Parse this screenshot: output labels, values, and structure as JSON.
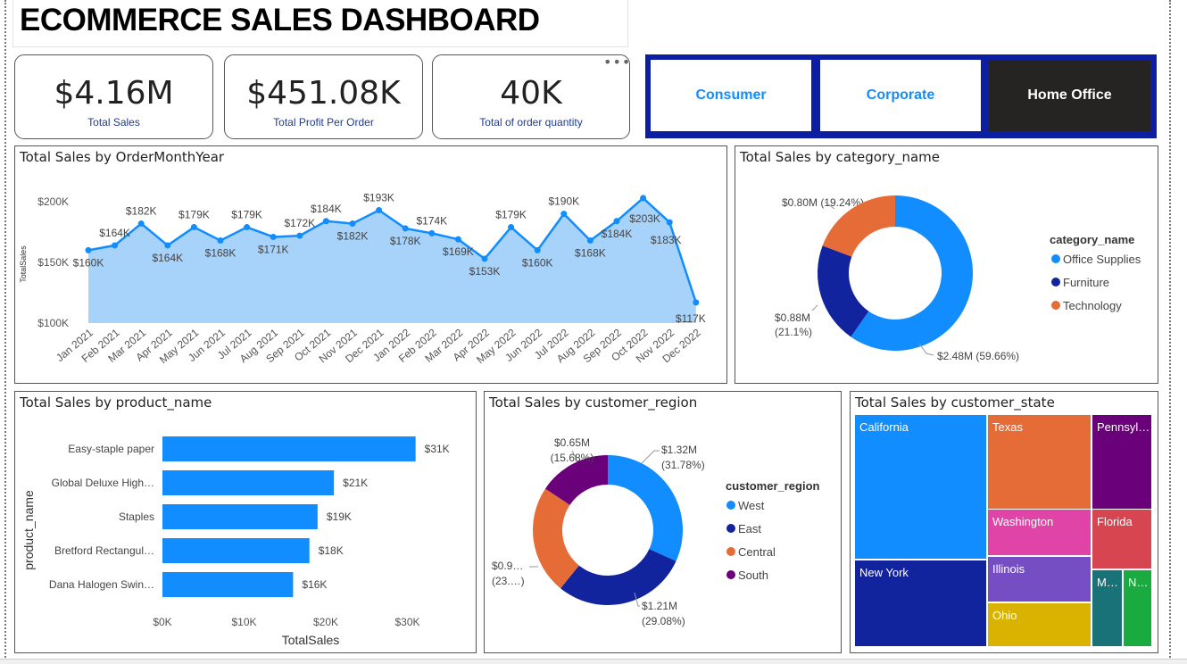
{
  "dashboard": {
    "title": "ECOMMERCE SALES DASHBOARD"
  },
  "kpis": [
    {
      "value": "$4.16M",
      "label": "Total Sales"
    },
    {
      "value": "$451.08K",
      "label": "Total Profit Per Order"
    },
    {
      "value": "40K",
      "label": "Total of order quantity"
    }
  ],
  "kpi_more_icon": "more-options-icon",
  "segment_slicer": {
    "options": [
      "Consumer",
      "Corporate",
      "Home Office"
    ],
    "selected": "Home Office",
    "colors": {
      "frame": "#0c1fa2",
      "selected_bg": "#252423",
      "text": "#118dff"
    }
  },
  "panels": {
    "monthly": "Total Sales by OrderMonthYear",
    "category": "Total Sales by category_name",
    "product": "Total Sales by product_name",
    "region": "Total Sales by customer_region",
    "state": "Total Sales by customer_state"
  },
  "chart_data": [
    {
      "type": "area",
      "title": "Total Sales by OrderMonthYear",
      "ylabel": "TotalSales",
      "xlabel": "",
      "x": [
        "Jan 2021",
        "Feb 2021",
        "Mar 2021",
        "Apr 2021",
        "May 2021",
        "Jun 2021",
        "Jul 2021",
        "Aug 2021",
        "Sep 2021",
        "Oct 2021",
        "Nov 2021",
        "Dec 2021",
        "Jan 2022",
        "Feb 2022",
        "Mar 2022",
        "Apr 2022",
        "May 2022",
        "Jun 2022",
        "Jul 2022",
        "Aug 2022",
        "Sep 2022",
        "Oct 2022",
        "Nov 2022",
        "Dec 2022"
      ],
      "values": [
        160,
        164,
        182,
        164,
        179,
        168,
        179,
        171,
        172,
        184,
        182,
        193,
        178,
        174,
        169,
        153,
        179,
        160,
        190,
        168,
        184,
        203,
        183,
        117
      ],
      "labels": [
        "$160K",
        "$164K",
        "$182K",
        "$164K",
        "$179K",
        "$168K",
        "$179K",
        "$171K",
        "$172K",
        "$184K",
        "$182K",
        "$193K",
        "$178K",
        "$174K",
        "$169K",
        "$153K",
        "$179K",
        "$160K",
        "$190K",
        "$168K",
        "$184K",
        "$203K",
        "$183K",
        "$117K"
      ],
      "yticks": [
        "$100K",
        "$150K",
        "$200K"
      ],
      "ylim": [
        100,
        210
      ],
      "colors": {
        "line": "#118dff",
        "fill": "#a7d2fa"
      }
    },
    {
      "type": "pie",
      "title": "Total Sales by category_name",
      "legend_title": "category_name",
      "legend_position": "right",
      "categories": [
        "Office Supplies",
        "Furniture",
        "Technology"
      ],
      "values": [
        59.66,
        21.1,
        19.24
      ],
      "labels": [
        "$2.48M (59.66%)",
        "$0.88M (21.1%)",
        "$0.80M (19.24%)"
      ],
      "colors": [
        "#118dff",
        "#12239e",
        "#e66c37"
      ]
    },
    {
      "type": "bar",
      "orientation": "horizontal",
      "title": "Total Sales by product_name",
      "ylabel": "product_name",
      "xlabel": "TotalSales",
      "categories": [
        "Easy-staple paper",
        "Global Deluxe High…",
        "Staples",
        "Bretford Rectangul…",
        "Dana Halogen Swin…"
      ],
      "values": [
        31,
        21,
        19,
        18,
        16
      ],
      "labels": [
        "$31K",
        "$21K",
        "$19K",
        "$18K",
        "$16K"
      ],
      "xticks": [
        "$0K",
        "$10K",
        "$20K",
        "$30K"
      ],
      "xlim": [
        0,
        33
      ],
      "color": "#118dff"
    },
    {
      "type": "pie",
      "title": "Total Sales by customer_region",
      "legend_title": "customer_region",
      "legend_position": "right",
      "categories": [
        "West",
        "East",
        "Central",
        "South"
      ],
      "values": [
        31.78,
        29.08,
        23.46,
        15.68
      ],
      "labels": [
        {
          "line1": "$1.32M",
          "line2": "(31.78%)"
        },
        {
          "line1": "$1.21M",
          "line2": "(29.08%)"
        },
        {
          "line1": "$0.9…",
          "line2": "(23.…)"
        },
        {
          "line1": "$0.65M",
          "line2": "(15.68%)"
        }
      ],
      "colors": [
        "#118dff",
        "#12239e",
        "#e66c37",
        "#6b007b"
      ]
    },
    {
      "type": "treemap",
      "title": "Total Sales by customer_state",
      "categories": [
        "California",
        "New York",
        "Texas",
        "Washington",
        "Illinois",
        "Ohio",
        "Pennsyl…",
        "Florida",
        "M…",
        "N…"
      ],
      "colors": [
        "#118dff",
        "#12239e",
        "#e66c37",
        "#e044a7",
        "#744ec2",
        "#d9b300",
        "#6b007b",
        "#d64550",
        "#197278",
        "#1aab40"
      ]
    }
  ]
}
